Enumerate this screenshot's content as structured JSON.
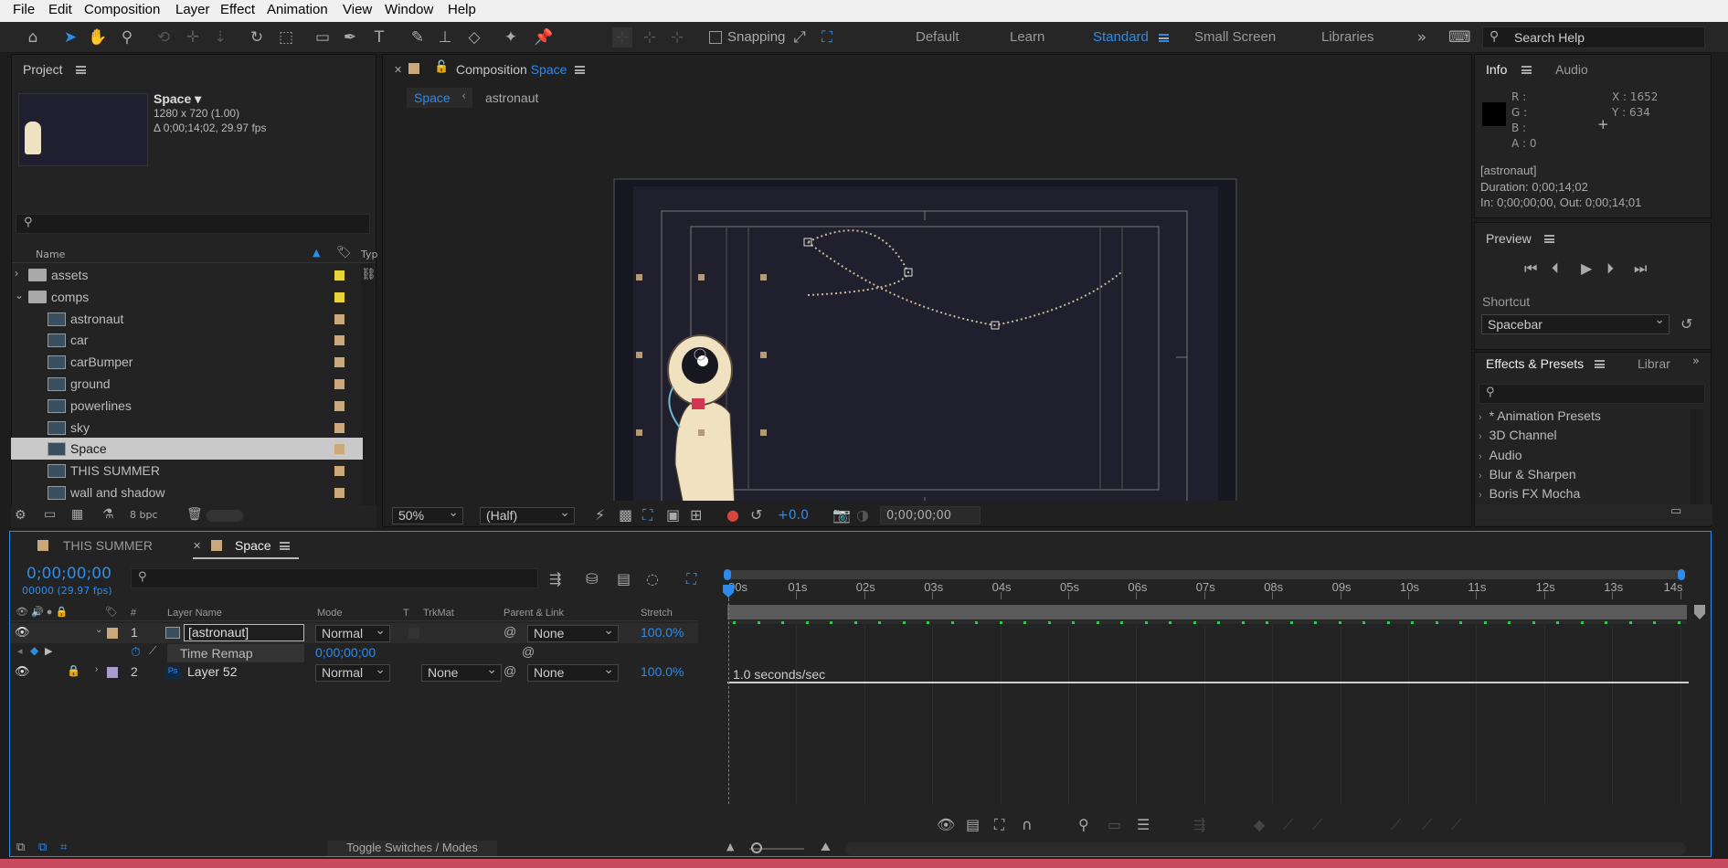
{
  "menu": [
    "File",
    "Edit",
    "Composition",
    "Layer",
    "Effect",
    "Animation",
    "View",
    "Window",
    "Help"
  ],
  "toolbar": {
    "snapping_label": "Snapping",
    "workspaces": [
      "Default",
      "Learn",
      "Standard",
      "Small Screen",
      "Libraries"
    ],
    "active_workspace": "Standard",
    "search_placeholder": "Search Help"
  },
  "project": {
    "title": "Project",
    "comp_name": "Space",
    "comp_size": "1280 x 720 (1.00)",
    "comp_duration": "Δ 0;00;14;02, 29.97 fps",
    "col_name": "Name",
    "col_type": "Typ",
    "items": [
      {
        "label": "assets",
        "kind": "folder",
        "color": "#e8d33a"
      },
      {
        "label": "comps",
        "kind": "folder",
        "color": "#e8d33a"
      },
      {
        "label": "astronaut",
        "kind": "comp",
        "color": "#c9a87a"
      },
      {
        "label": "car",
        "kind": "comp",
        "color": "#c9a87a"
      },
      {
        "label": "carBumper",
        "kind": "comp",
        "color": "#c9a87a"
      },
      {
        "label": "ground",
        "kind": "comp",
        "color": "#c9a87a"
      },
      {
        "label": "powerlines",
        "kind": "comp",
        "color": "#c9a87a"
      },
      {
        "label": "sky",
        "kind": "comp",
        "color": "#c9a87a"
      },
      {
        "label": "Space",
        "kind": "comp",
        "color": "#c9a87a",
        "selected": true
      },
      {
        "label": "THIS SUMMER",
        "kind": "comp",
        "color": "#c9a87a"
      },
      {
        "label": "wall and shadow",
        "kind": "comp",
        "color": "#c9a87a"
      }
    ],
    "bpc": "8 bpc"
  },
  "composition": {
    "tab_prefix": "Composition",
    "tab_name": "Space",
    "breadcrumb": [
      "Space",
      "astronaut"
    ],
    "zoom": "50%",
    "resolution": "(Half)",
    "exposure": "+0.0",
    "timecode": "0;00;00;00"
  },
  "info": {
    "tab_info": "Info",
    "tab_audio": "Audio",
    "r": "R :",
    "g": "G :",
    "b": "B :",
    "a": "A : 0",
    "x": "X : 1652",
    "y": "Y : 634",
    "layer": "[astronaut]",
    "duration": "Duration: 0;00;14;02",
    "inout": "In: 0;00;00;00, Out: 0;00;14;01"
  },
  "preview": {
    "title": "Preview",
    "shortcut_label": "Shortcut",
    "shortcut_value": "Spacebar"
  },
  "effects": {
    "title": "Effects & Presets",
    "other_tab": "Librar",
    "items": [
      "* Animation Presets",
      "3D Channel",
      "Audio",
      "Blur & Sharpen",
      "Boris FX Mocha"
    ]
  },
  "timeline": {
    "tabs": [
      "THIS SUMMER",
      "Space"
    ],
    "timecode": "0;00;00;00",
    "frames": "00000 (29.97 fps)",
    "columns": {
      "num": "#",
      "layer_name": "Layer Name",
      "mode": "Mode",
      "t": "T",
      "trkmat": "TrkMat",
      "parent": "Parent & Link",
      "stretch": "Stretch"
    },
    "layers": [
      {
        "num": "1",
        "name": "[astronaut]",
        "mode": "Normal",
        "trkmat": "",
        "parent": "None",
        "stretch": "100.0%",
        "color": "#c9a87a"
      },
      {
        "num": "2",
        "name": "Layer 52",
        "mode": "Normal",
        "trkmat": "None",
        "parent": "None",
        "stretch": "100.0%",
        "color": "#a99bd0"
      }
    ],
    "time_remap_label": "Time Remap",
    "time_remap_value": "0;00;00;00",
    "graph_label": "1.0 seconds/sec",
    "ticks": [
      "00s",
      "01s",
      "02s",
      "03s",
      "04s",
      "05s",
      "06s",
      "07s",
      "08s",
      "09s",
      "10s",
      "11s",
      "12s",
      "13s",
      "14s"
    ],
    "toggle_label": "Toggle Switches / Modes"
  }
}
